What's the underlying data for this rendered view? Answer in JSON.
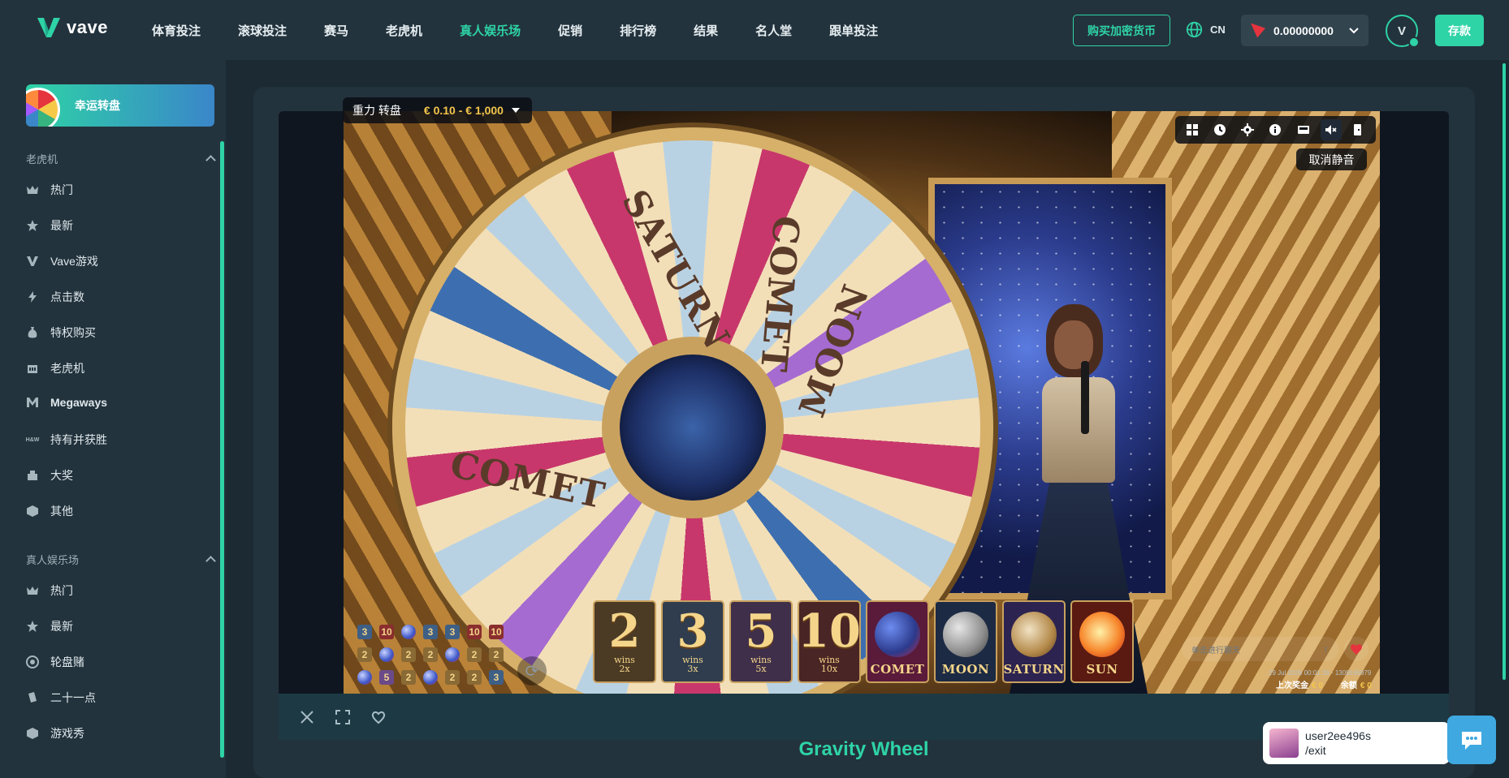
{
  "brand": {
    "name": "vave",
    "accent": "#2ed3a6"
  },
  "nav": {
    "items": [
      {
        "label": "体育投注",
        "active": false
      },
      {
        "label": "滚球投注",
        "active": false
      },
      {
        "label": "赛马",
        "active": false
      },
      {
        "label": "老虎机",
        "active": false
      },
      {
        "label": "真人娱乐场",
        "active": true
      },
      {
        "label": "促销",
        "active": false
      },
      {
        "label": "排行榜",
        "active": false
      },
      {
        "label": "结果",
        "active": false
      },
      {
        "label": "名人堂",
        "active": false
      },
      {
        "label": "跟单投注",
        "active": false
      }
    ],
    "buy_crypto": "购买加密货币",
    "lang": "CN",
    "balance": "0.00000000",
    "avatar_letter": "V",
    "deposit": "存款"
  },
  "sidebar": {
    "lucky_wheel": "幸运转盘",
    "slots": {
      "title": "老虎机",
      "items": [
        "热门",
        "最新",
        "Vave游戏",
        "点击数",
        "特权购买",
        "老虎机",
        "Megaways",
        "持有并获胜",
        "大奖",
        "其他"
      ]
    },
    "live": {
      "title": "真人娱乐场",
      "items": [
        "热门",
        "最新",
        "轮盘赌",
        "二十一点",
        "游戏秀"
      ]
    }
  },
  "game": {
    "title": "Gravity Wheel",
    "overlay_name": "重力 转盘",
    "limits": "€ 0.10 - € 1,000",
    "unmute": "取消静音",
    "wheel_labels": [
      "SATURN",
      "COMET",
      "MOON",
      "COMET"
    ],
    "history": [
      [
        "3",
        "10",
        "",
        "3",
        "3",
        "10",
        "10"
      ],
      [
        "2",
        "",
        "2",
        "2",
        "",
        "2",
        "2"
      ],
      [
        "",
        "5",
        "2",
        "",
        "2",
        "2",
        "3"
      ]
    ],
    "bets": [
      {
        "num": "2",
        "wins": "wins",
        "mult": "2x",
        "bg": "#4b3a24"
      },
      {
        "num": "3",
        "wins": "wins",
        "mult": "3x",
        "bg": "#2f3d4f"
      },
      {
        "num": "5",
        "wins": "wins",
        "mult": "5x",
        "bg": "#3f2f4a"
      },
      {
        "num": "10",
        "wins": "wins",
        "mult": "10x",
        "bg": "#4a2525"
      }
    ],
    "specials": [
      {
        "name": "COMET",
        "bg": "#5a1a3a",
        "orb": "radial-gradient(circle at 35% 35%, #6c8cf0, #2c3a8c 60%, #b32b4a)"
      },
      {
        "name": "MOON",
        "bg": "#1c2a44",
        "orb": "radial-gradient(circle at 35% 35%, #e6e6e6, #8d8d8d 60%, #3a3a3a)"
      },
      {
        "name": "SATURN",
        "bg": "#2c2350",
        "orb": "radial-gradient(circle at 40% 40%, #f1e2c4, #b48a4a 60%, #5a3b1a)"
      },
      {
        "name": "SUN",
        "bg": "#5a1a12",
        "orb": "radial-gradient(circle at 45% 45%, #fff1a8, #f7882d 55%, #c21f12)"
      }
    ],
    "chat_placeholder": "单击进行聊天",
    "timestamp": "29 Jul 2026 00:01:29 - 1309165979",
    "last_win_label": "上次奖金",
    "last_win_value": "€ 0",
    "balance_label": "余额",
    "balance_value": "€ 0"
  },
  "user": {
    "name": "user2ee496s",
    "action": "/exit"
  }
}
